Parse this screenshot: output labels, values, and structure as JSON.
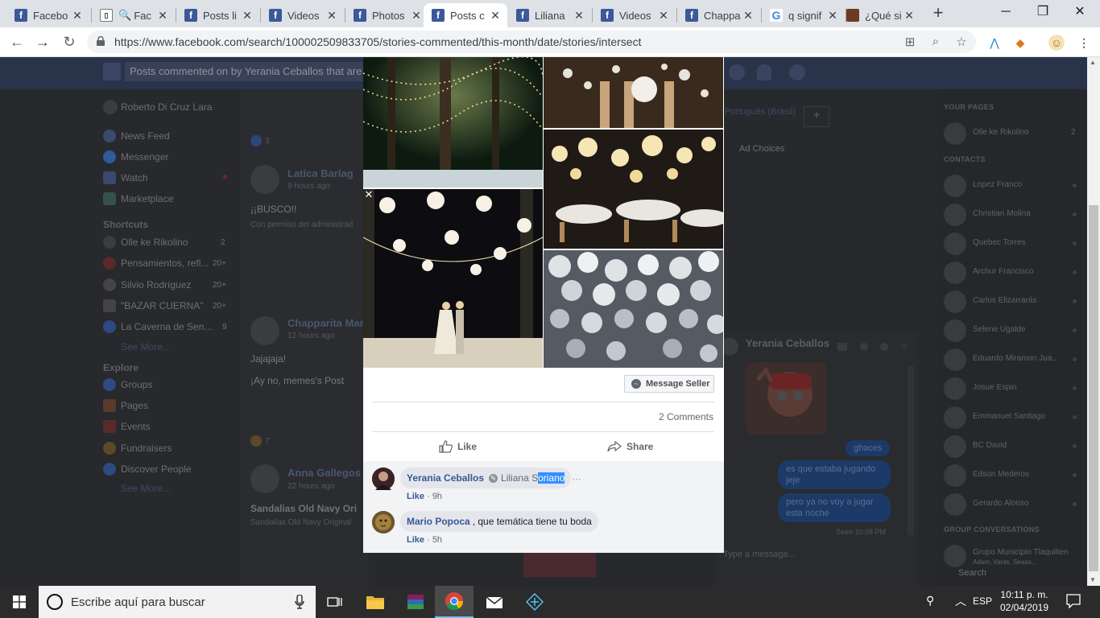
{
  "browser": {
    "tabs": [
      {
        "title": "Facebo",
        "icon": "facebook-icon"
      },
      {
        "title": "Fac",
        "icon": "search-icon"
      },
      {
        "title": "Posts li",
        "icon": "facebook-icon"
      },
      {
        "title": "Videos",
        "icon": "facebook-icon"
      },
      {
        "title": "Photos",
        "icon": "facebook-icon"
      },
      {
        "title": "Posts c",
        "icon": "facebook-icon",
        "active": true
      },
      {
        "title": "Liliana",
        "icon": "facebook-icon"
      },
      {
        "title": "Videos",
        "icon": "facebook-icon"
      },
      {
        "title": "Chappa",
        "icon": "facebook-icon"
      },
      {
        "title": "q signif",
        "icon": "google-icon"
      },
      {
        "title": "¿Qué si",
        "icon": "page-icon"
      }
    ],
    "new_tab": "+",
    "url": "https://www.facebook.com/search/100002509833705/stories-commented/this-month/date/stories/intersect"
  },
  "facebook_bg": {
    "search_text": "Posts commented on by Yerania Ceballos that are f",
    "profile_name": "Roberto Di Cruz Lara",
    "nav": [
      "News Feed",
      "Messenger",
      "Watch",
      "Marketplace"
    ],
    "shortcuts_heading": "Shortcuts",
    "shortcuts": [
      {
        "label": "Olle ke Rikolino",
        "count": "2"
      },
      {
        "label": "Pensamientos, refl...",
        "count": "20+"
      },
      {
        "label": "Silvio Rodríguez",
        "count": "20+"
      },
      {
        "label": "\"BAZAR CUERNA\"",
        "count": "20+"
      },
      {
        "label": "La Caverna de Sen...",
        "count": "9"
      }
    ],
    "see_more": "See More...",
    "explore_heading": "Explore",
    "explore": [
      "Groups",
      "Pages",
      "Events",
      "Fundraisers",
      "Discover People"
    ],
    "posts": [
      {
        "name": "Latica Barlag",
        "time": "9 hours ago",
        "text": "¡¡BUSCO!!",
        "subtext": "Con permiso del administrad"
      },
      {
        "name": "Chapparita Mar",
        "time": "12 hours ago",
        "text": "Jajajaja!",
        "subtext": "¡Ay no, memes's Post"
      },
      {
        "name": "Anna Gallegos",
        "time": "22 hours ago",
        "text": "Sandalias Old Navy Ori",
        "subtext": "Sandalias Old Navy Original"
      }
    ],
    "reaction_counts": [
      "3",
      "7"
    ],
    "language": "Português (Brasil)",
    "ad_choices": "Ad Choices",
    "your_pages_heading": "YOUR PAGES",
    "your_pages": [
      {
        "name": "Olle ke Rikolino",
        "count": "2"
      }
    ],
    "contacts_heading": "CONTACTS",
    "contacts": [
      "Lopez Franco",
      "Christian Molina",
      "Quebec Torres",
      "Archur Francisco",
      "Carlos Elizarrarás",
      "Selene Ugalde",
      "Eduardo Miramon Jua...",
      "Josue Espin",
      "Emmanuel Santiago",
      "BC David",
      "Edson Mederos",
      "Gerardo Alonso"
    ],
    "group_conv_heading": "GROUP CONVERSATIONS",
    "group_conv": "Grupo Municipio Tlaquilten",
    "group_conv_sub": "Adam, Varas, Seaso...",
    "sidebar_search": "Search",
    "chat": {
      "name": "Yerania Ceballos",
      "messages": [
        "ghaces",
        "es que estaba jugando jeje",
        "pero ya no voy a jugar esta noche"
      ],
      "seen": "Seen 10:08 PM",
      "placeholder": "Type a message..."
    }
  },
  "modal": {
    "message_seller": "Message Seller",
    "comments_count": "2 Comments",
    "like": "Like",
    "share": "Share",
    "comments": [
      {
        "author": "Yerania Ceballos",
        "tag_pre": "Liliana S",
        "tag_sel": "oriano",
        "like": "Like",
        "time": "9h"
      },
      {
        "author": "Mario Popoca",
        "text": ", que temática tiene tu boda",
        "like": "Like",
        "time": "5h"
      }
    ]
  },
  "taskbar": {
    "search_placeholder": "Escribe aquí para buscar",
    "language": "ESP",
    "time": "10:11 p. m.",
    "date": "02/04/2019"
  },
  "colors": {
    "facebook_blue": "#3b5998",
    "link_blue": "#385898",
    "taskbar": "#2b2b2b",
    "selection": "#3390ff"
  }
}
